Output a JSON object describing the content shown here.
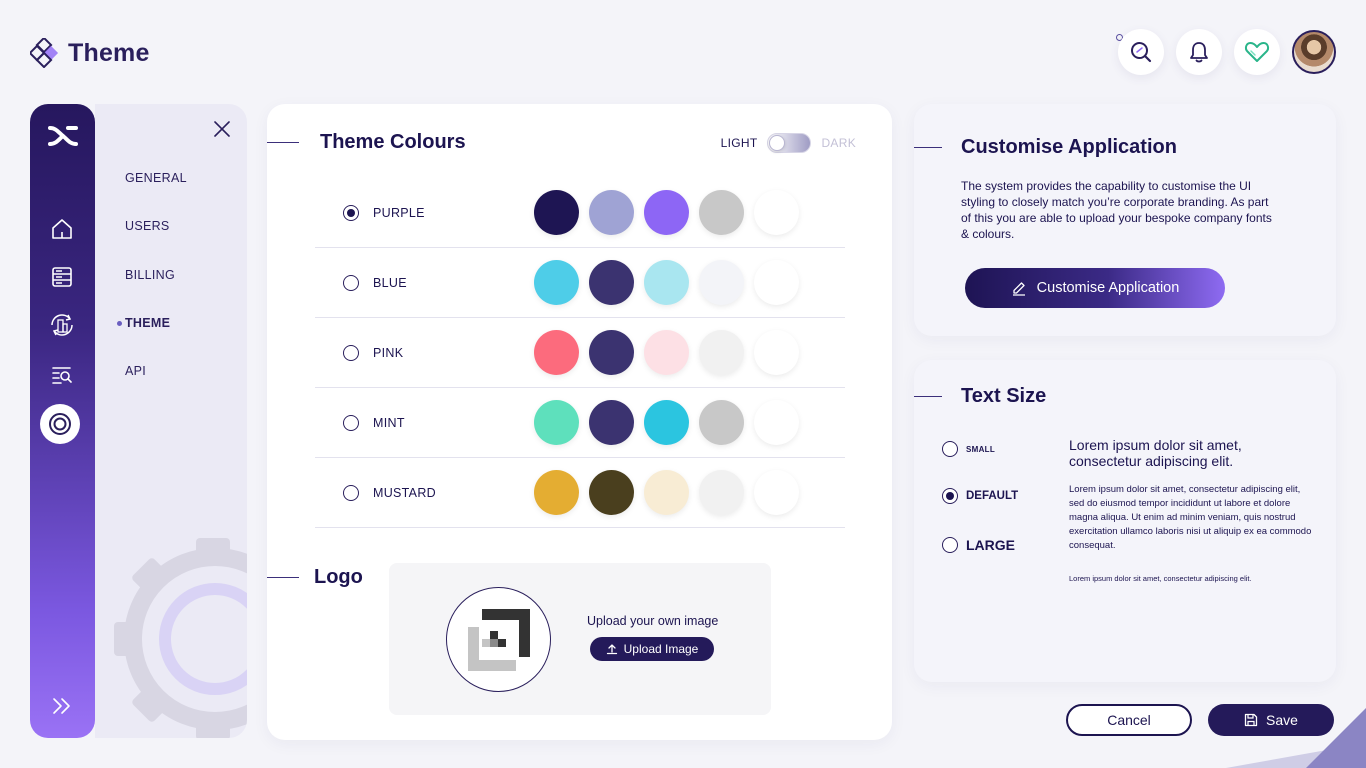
{
  "app": {
    "title": "Theme"
  },
  "header": {
    "icons": [
      "search-icon",
      "bell-icon",
      "heart-icon"
    ],
    "accent": "#2a1f5c"
  },
  "rail": {
    "items": [
      "home-icon",
      "server-icon",
      "building-sync-icon",
      "search-list-icon",
      "settings-icon"
    ],
    "active": "settings-icon"
  },
  "submenu": {
    "items": [
      {
        "label": "GENERAL"
      },
      {
        "label": "USERS"
      },
      {
        "label": "BILLING"
      },
      {
        "label": "THEME",
        "active": true
      },
      {
        "label": "API"
      }
    ]
  },
  "theme_colours": {
    "title": "Theme Colours",
    "toggle_light": "LIGHT",
    "toggle_dark": "DARK",
    "mode": "light",
    "themes": [
      {
        "label": "PURPLE",
        "selected": true,
        "colors": [
          "#1e1553",
          "#9fa3d4",
          "#8d66f5",
          "#c8c8c8",
          "#ffffff"
        ]
      },
      {
        "label": "BLUE",
        "selected": false,
        "colors": [
          "#4ecde8",
          "#3b3370",
          "#a9e6f0",
          "#f3f4f8",
          "#ffffff"
        ]
      },
      {
        "label": "PINK",
        "selected": false,
        "colors": [
          "#fc6b7d",
          "#3b3370",
          "#fde0e5",
          "#f1f1f1",
          "#ffffff"
        ]
      },
      {
        "label": "MINT",
        "selected": false,
        "colors": [
          "#5ee0bc",
          "#3b3370",
          "#2bc5e0",
          "#c8c8c8",
          "#ffffff"
        ]
      },
      {
        "label": "MUSTARD",
        "selected": false,
        "colors": [
          "#e4ad32",
          "#4a3f1e",
          "#f8ecd4",
          "#f1f1f1",
          "#ffffff"
        ]
      }
    ]
  },
  "logo": {
    "title": "Logo",
    "caption": "Upload your own image",
    "upload_label": "Upload Image"
  },
  "customise": {
    "title": "Customise Application",
    "description": "The system provides the capability to customise the UI styling to closely match you’re corporate branding. As part of this you are able to upload your bespoke company fonts & colours.",
    "button_label": "Customise Application"
  },
  "text_size": {
    "title": "Text Size",
    "options": [
      {
        "label": "SMALL",
        "selected": false
      },
      {
        "label": "DEFAULT",
        "selected": true
      },
      {
        "label": "LARGE",
        "selected": false
      }
    ],
    "sample_large": "Lorem ipsum dolor sit amet, consectetur adipiscing elit.",
    "sample_default": "Lorem ipsum dolor sit amet, consectetur adipiscing elit, sed do eiusmod tempor incididunt ut labore et dolore magna aliqua. Ut enim ad minim veniam, quis nostrud exercitation ullamco laboris nisi ut aliquip ex ea commodo  consequat.",
    "sample_small": "Lorem ipsum dolor sit amet, consectetur adipiscing elit."
  },
  "footer": {
    "cancel_label": "Cancel",
    "save_label": "Save"
  }
}
